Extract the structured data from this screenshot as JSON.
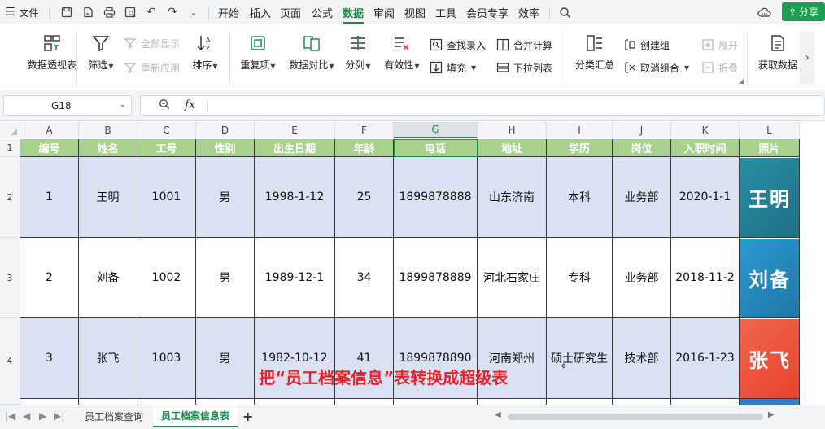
{
  "menubar": {
    "file_label": "文件",
    "tabs": [
      "开始",
      "插入",
      "页面",
      "公式",
      "数据",
      "审阅",
      "视图",
      "工具",
      "会员专享",
      "效率"
    ],
    "active_tab": "数据",
    "share_label": "分享"
  },
  "ribbon": {
    "pivot": "数据透视表",
    "filter": "筛选",
    "show_all": "全部显示",
    "reapply": "重新应用",
    "sort": "排序",
    "duplicates": "重复项",
    "compare": "数据对比",
    "split": "分列",
    "validity": "有效性",
    "lookup_entry": "查找录入",
    "fill": "填充",
    "merge_calc": "合并计算",
    "dropdown_list": "下拉列表",
    "subtotal": "分类汇总",
    "create_group": "创建组",
    "ungroup": "取消组合",
    "expand": "展开",
    "collapse": "折叠",
    "get_data": "获取数据"
  },
  "formula_bar": {
    "cell_ref": "G18",
    "fx": "fx",
    "value": ""
  },
  "columns": [
    "A",
    "B",
    "C",
    "D",
    "E",
    "F",
    "G",
    "H",
    "I",
    "J",
    "K",
    "L"
  ],
  "selected_column": "G",
  "rows": [
    "1",
    "2",
    "3",
    "4"
  ],
  "table": {
    "headers": [
      "编号",
      "姓名",
      "工号",
      "性别",
      "出生日期",
      "年龄",
      "电话",
      "地址",
      "学历",
      "岗位",
      "入职时间",
      "照片"
    ],
    "data": [
      [
        "1",
        "王明",
        "1001",
        "男",
        "1998-1-12",
        "25",
        "1899878888",
        "山东济南",
        "本科",
        "业务部",
        "2020-1-1"
      ],
      [
        "2",
        "刘备",
        "1002",
        "男",
        "1989-12-1",
        "34",
        "1899878889",
        "河北石家庄",
        "专科",
        "业务部",
        "2018-11-2"
      ],
      [
        "3",
        "张飞",
        "1003",
        "男",
        "1982-10-12",
        "41",
        "1899878890",
        "河南郑州",
        "硕士研究生",
        "技术部",
        "2016-1-23"
      ]
    ],
    "photos": [
      "王明",
      "刘备",
      "张飞"
    ]
  },
  "colors": {
    "header_bg": "#a9d18e",
    "row_blue": "#d9e1f2",
    "accent": "#1d8a4e",
    "caption": "#e8222a"
  },
  "caption": "把“员工档案信息”表转换成超级表",
  "sheets": [
    "员工档案查询",
    "员工档案信息表"
  ],
  "active_sheet": "员工档案信息表"
}
